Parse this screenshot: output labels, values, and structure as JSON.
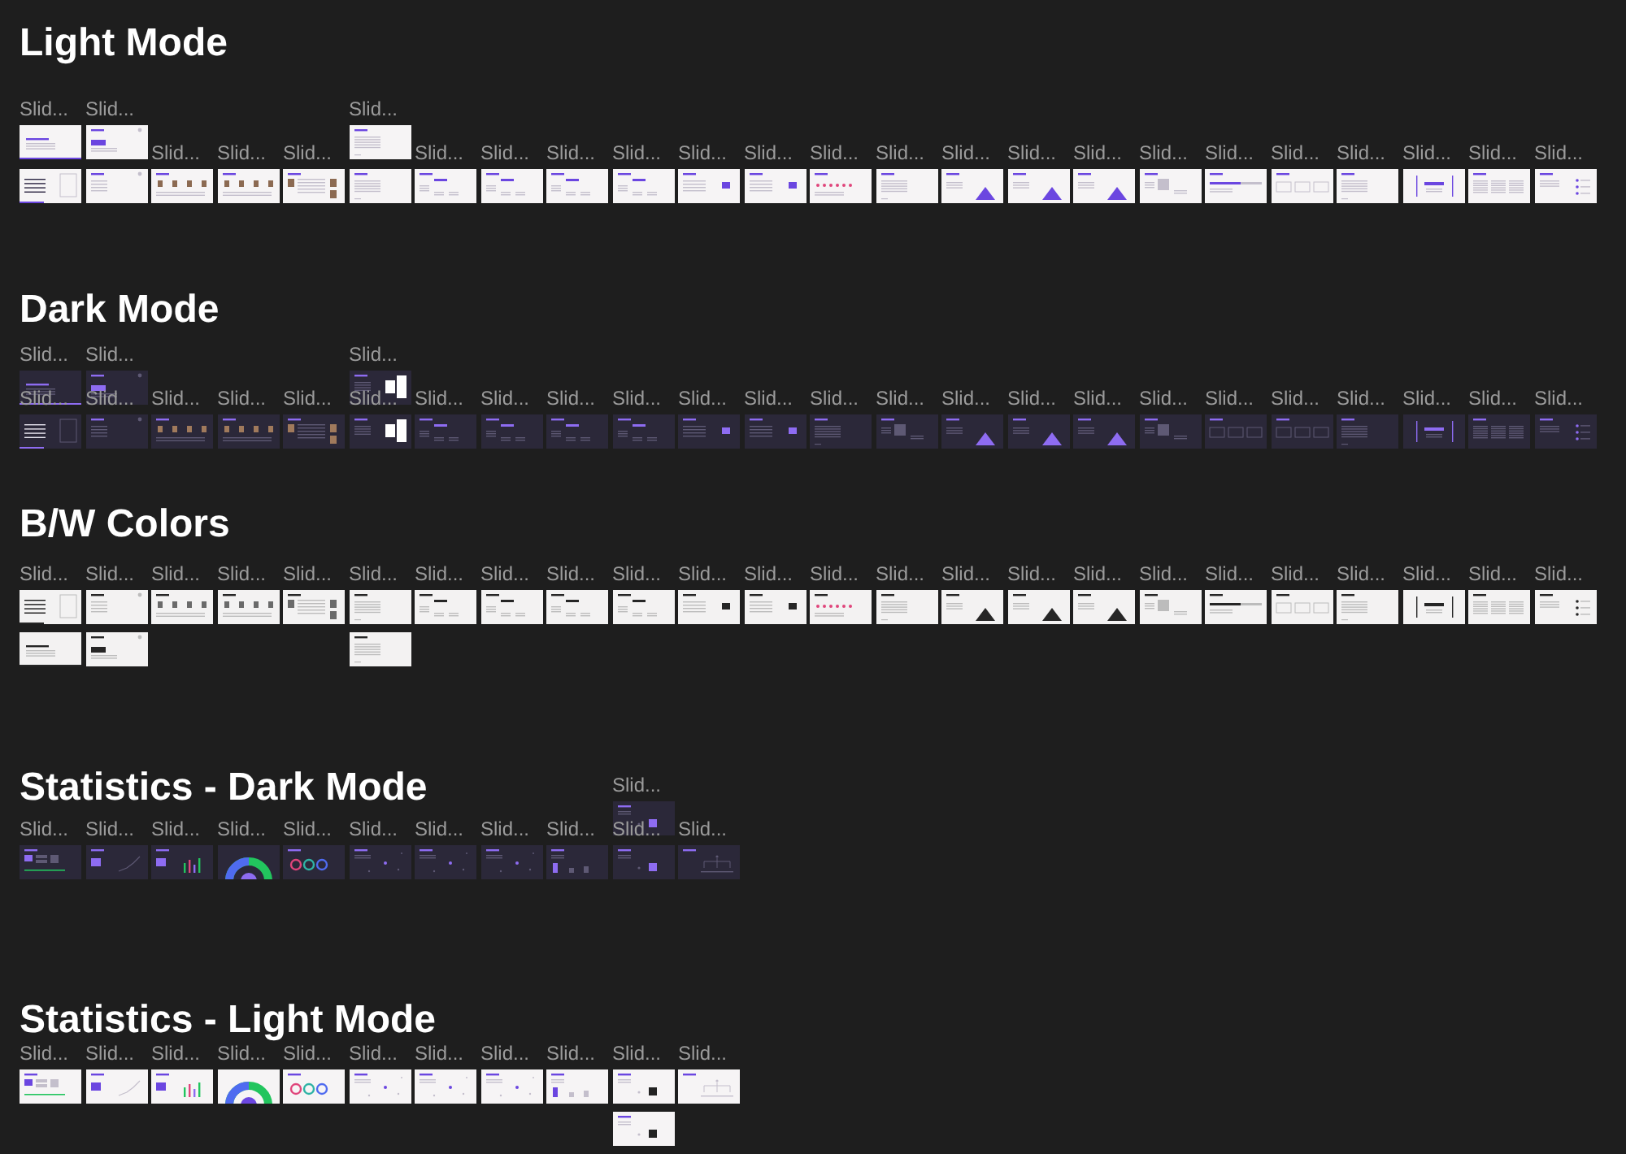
{
  "sections": [
    {
      "title": "Light Mode",
      "kind": "light",
      "rows": [
        {
          "cells": [
            {
              "label": "Slid...",
              "kind": "cover2"
            },
            {
              "label": "Slid...",
              "kind": "bar"
            },
            {},
            {},
            {},
            {
              "label": "Slid...",
              "kind": "text"
            }
          ]
        },
        {
          "cells": [
            {
              "kind": "cover"
            },
            {
              "kind": "titlelist"
            },
            {
              "label": "Slid...",
              "kind": "profiles"
            },
            {
              "label": "Slid...",
              "kind": "profiles"
            },
            {
              "label": "Slid...",
              "kind": "profiletext"
            },
            {
              "kind": "text"
            },
            {
              "label": "Slid...",
              "kind": "tags"
            },
            {
              "label": "Slid...",
              "kind": "tags"
            },
            {
              "label": "Slid...",
              "kind": "tags"
            },
            {
              "label": "Slid...",
              "kind": "tags"
            },
            {
              "label": "Slid...",
              "kind": "chart"
            },
            {
              "label": "Slid...",
              "kind": "chart"
            },
            {
              "label": "Slid...",
              "kind": "stars"
            },
            {
              "label": "Slid...",
              "kind": "text"
            },
            {
              "label": "Slid...",
              "kind": "triangle"
            },
            {
              "label": "Slid...",
              "kind": "triangle"
            },
            {
              "label": "Slid...",
              "kind": "triangle"
            },
            {
              "label": "Slid...",
              "kind": "image"
            },
            {
              "label": "Slid...",
              "kind": "progress"
            },
            {
              "label": "Slid...",
              "kind": "boxes"
            },
            {
              "label": "Slid...",
              "kind": "text"
            },
            {
              "label": "Slid...",
              "kind": "thanks"
            },
            {
              "label": "Slid...",
              "kind": "columns"
            },
            {
              "label": "Slid...",
              "kind": "list"
            }
          ]
        }
      ]
    },
    {
      "title": "Dark Mode",
      "kind": "dark",
      "rows": [
        {
          "cells": [
            {
              "label": "Slid...",
              "kind": "cover2"
            },
            {
              "label": "Slid...",
              "kind": "bar"
            },
            {},
            {},
            {},
            {
              "label": "Slid...",
              "kind": "stack"
            }
          ]
        },
        {
          "cells": [
            {
              "label": "Slid...",
              "kind": "cover"
            },
            {
              "label": "Slid...",
              "kind": "titlelist"
            },
            {
              "label": "Slid...",
              "kind": "profiles"
            },
            {
              "label": "Slid...",
              "kind": "profiles"
            },
            {
              "label": "Slid...",
              "kind": "profiletext"
            },
            {
              "label": "Slid...",
              "kind": "stack"
            },
            {
              "label": "Slid...",
              "kind": "tags"
            },
            {
              "label": "Slid...",
              "kind": "tags"
            },
            {
              "label": "Slid...",
              "kind": "tags"
            },
            {
              "label": "Slid...",
              "kind": "tags"
            },
            {
              "label": "Slid...",
              "kind": "chart"
            },
            {
              "label": "Slid...",
              "kind": "chart"
            },
            {
              "label": "Slid...",
              "kind": "text"
            },
            {
              "label": "Slid...",
              "kind": "image"
            },
            {
              "label": "Slid...",
              "kind": "triangle"
            },
            {
              "label": "Slid...",
              "kind": "triangle"
            },
            {
              "label": "Slid...",
              "kind": "triangle"
            },
            {
              "label": "Slid...",
              "kind": "image"
            },
            {
              "label": "Slid...",
              "kind": "boxes"
            },
            {
              "label": "Slid...",
              "kind": "boxes"
            },
            {
              "label": "Slid...",
              "kind": "text"
            },
            {
              "label": "Slid...",
              "kind": "thanks"
            },
            {
              "label": "Slid...",
              "kind": "columns"
            },
            {
              "label": "Slid...",
              "kind": "list"
            }
          ]
        }
      ]
    },
    {
      "title": "B/W Colors",
      "kind": "bw",
      "rows": [
        {
          "cells": [
            {
              "label": "Slid...",
              "kind": "cover"
            },
            {
              "label": "Slid...",
              "kind": "titlelist"
            },
            {
              "label": "Slid...",
              "kind": "profiles"
            },
            {
              "label": "Slid...",
              "kind": "profiles"
            },
            {
              "label": "Slid...",
              "kind": "profiletext"
            },
            {
              "label": "Slid...",
              "kind": "text"
            },
            {
              "label": "Slid...",
              "kind": "tags"
            },
            {
              "label": "Slid...",
              "kind": "tags"
            },
            {
              "label": "Slid...",
              "kind": "tags"
            },
            {
              "label": "Slid...",
              "kind": "tags"
            },
            {
              "label": "Slid...",
              "kind": "chart"
            },
            {
              "label": "Slid...",
              "kind": "chart"
            },
            {
              "label": "Slid...",
              "kind": "stars"
            },
            {
              "label": "Slid...",
              "kind": "text"
            },
            {
              "label": "Slid...",
              "kind": "triangle"
            },
            {
              "label": "Slid...",
              "kind": "triangle"
            },
            {
              "label": "Slid...",
              "kind": "triangle"
            },
            {
              "label": "Slid...",
              "kind": "image"
            },
            {
              "label": "Slid...",
              "kind": "progress"
            },
            {
              "label": "Slid...",
              "kind": "boxes"
            },
            {
              "label": "Slid...",
              "kind": "text"
            },
            {
              "label": "Slid...",
              "kind": "thanks"
            },
            {
              "label": "Slid...",
              "kind": "columns"
            },
            {
              "label": "Slid...",
              "kind": "list"
            }
          ]
        },
        {
          "cells": [
            {
              "kind": "cover2"
            },
            {
              "kind": "bar"
            },
            {},
            {},
            {},
            {
              "kind": "text"
            }
          ]
        }
      ]
    },
    {
      "title": "Statistics - Dark Mode",
      "kind": "dark",
      "rows": [
        {
          "cells": [
            {},
            {},
            {},
            {},
            {},
            {},
            {},
            {},
            {},
            {
              "label": "Slid...",
              "kind": "tile"
            }
          ]
        },
        {
          "cells": [
            {
              "label": "Slid...",
              "kind": "dashboard"
            },
            {
              "label": "Slid...",
              "kind": "line"
            },
            {
              "label": "Slid...",
              "kind": "candles"
            },
            {
              "label": "Slid...",
              "kind": "donut"
            },
            {
              "label": "Slid...",
              "kind": "rings"
            },
            {
              "label": "Slid...",
              "kind": "scatter"
            },
            {
              "label": "Slid...",
              "kind": "scatter"
            },
            {
              "label": "Slid...",
              "kind": "scatter"
            },
            {
              "label": "Slid...",
              "kind": "bars"
            },
            {
              "label": "Slid...",
              "kind": "tile"
            },
            {
              "label": "Slid...",
              "kind": "tree"
            }
          ]
        }
      ]
    },
    {
      "title": "Statistics - Light Mode",
      "kind": "light",
      "rows": [
        {
          "cells": [
            {
              "label": "Slid...",
              "kind": "dashboard"
            },
            {
              "label": "Slid...",
              "kind": "line"
            },
            {
              "label": "Slid...",
              "kind": "candles"
            },
            {
              "label": "Slid...",
              "kind": "donut"
            },
            {
              "label": "Slid...",
              "kind": "rings"
            },
            {
              "label": "Slid...",
              "kind": "scatter"
            },
            {
              "label": "Slid...",
              "kind": "scatter"
            },
            {
              "label": "Slid...",
              "kind": "scatter"
            },
            {
              "label": "Slid...",
              "kind": "bars"
            },
            {
              "label": "Slid...",
              "kind": "tile"
            },
            {
              "label": "Slid...",
              "kind": "tree"
            }
          ]
        },
        {
          "cells": [
            {},
            {},
            {},
            {},
            {},
            {},
            {},
            {},
            {},
            {
              "kind": "tile"
            }
          ]
        }
      ]
    }
  ]
}
